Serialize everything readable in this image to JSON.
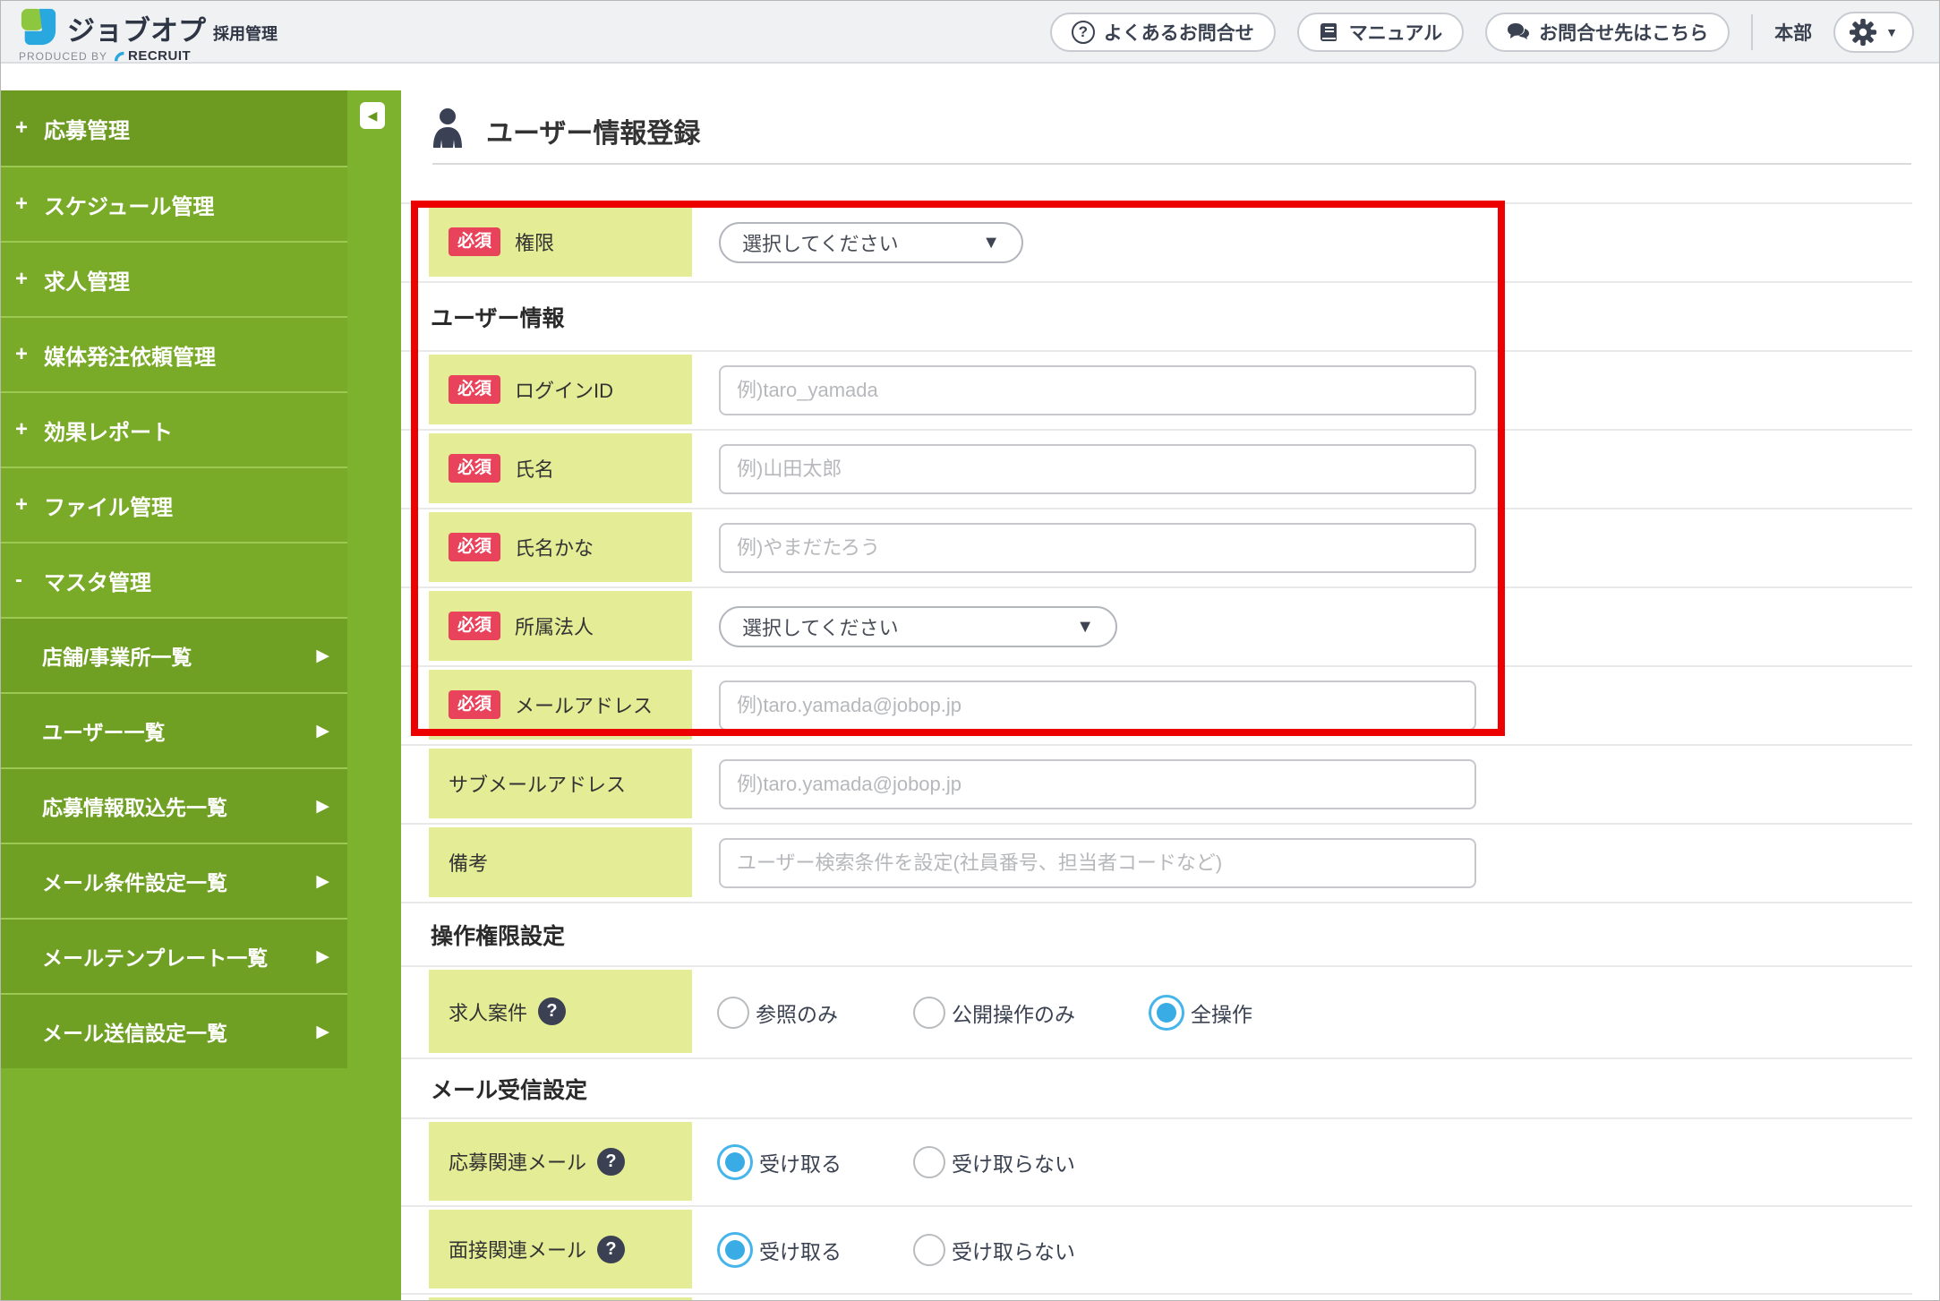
{
  "colors": {
    "sidebar_green": "#7cb22d",
    "label_cell_bg": "#e4ec95",
    "required_red": "#e8435a",
    "highlight_border_red": "#ec0000",
    "radio_selected_blue": "#39ace6",
    "icon_navy": "#3a4150"
  },
  "header": {
    "logo": {
      "product": "ジョブオプ",
      "suffix": "採用管理",
      "produced_by": "PRODUCED BY",
      "brand": "RECRUIT"
    },
    "nav_buttons": [
      {
        "label": "よくあるお問合せ",
        "icon": "question-circle-icon"
      },
      {
        "label": "マニュアル",
        "icon": "book-icon"
      },
      {
        "label": "お問合せ先はこちら",
        "icon": "chat-bubble-icon"
      }
    ],
    "org_label": "本部",
    "settings": {
      "icon": "gear-icon",
      "caret": "▼"
    }
  },
  "sidebar": {
    "collapse_icon": "◀",
    "arrow_icon": "▶",
    "items": [
      {
        "prefix": "+",
        "label": "応募管理"
      },
      {
        "prefix": "+",
        "label": "スケジュール管理"
      },
      {
        "prefix": "+",
        "label": "求人管理"
      },
      {
        "prefix": "+",
        "label": "媒体発注依頼管理"
      },
      {
        "prefix": "+",
        "label": "効果レポート"
      },
      {
        "prefix": "+",
        "label": "ファイル管理"
      },
      {
        "prefix": "-",
        "label": "マスタ管理"
      },
      {
        "prefix": "",
        "label": "店舗/事業所一覧"
      },
      {
        "prefix": "",
        "label": "ユーザー一覧"
      },
      {
        "prefix": "",
        "label": "応募情報取込先一覧"
      },
      {
        "prefix": "",
        "label": "メール条件設定一覧"
      },
      {
        "prefix": "",
        "label": "メールテンプレート一覧"
      },
      {
        "prefix": "",
        "label": "メール送信設定一覧"
      }
    ]
  },
  "page": {
    "title": "ユーザー情報登録",
    "required_badge": "必須",
    "select_caret": "▼",
    "help_icon": "?",
    "rows": [
      {
        "label": "権限",
        "required": true,
        "control": "select",
        "value": "選択してください"
      },
      {
        "type": "section",
        "label": "ユーザー情報"
      },
      {
        "label": "ログインID",
        "required": true,
        "control": "input",
        "placeholder": "例)taro_yamada"
      },
      {
        "label": "氏名",
        "required": true,
        "control": "input",
        "placeholder": "例)山田太郎"
      },
      {
        "label": "氏名かな",
        "required": true,
        "control": "input",
        "placeholder": "例)やまだたろう"
      },
      {
        "label": "所属法人",
        "required": true,
        "control": "select",
        "value": "選択してください"
      },
      {
        "label": "メールアドレス",
        "required": true,
        "control": "input",
        "placeholder": "例)taro.yamada@jobop.jp"
      },
      {
        "label": "サブメールアドレス",
        "required": false,
        "control": "input",
        "placeholder": "例)taro.yamada@jobop.jp"
      },
      {
        "label": "備考",
        "required": false,
        "control": "input",
        "placeholder": "ユーザー検索条件を設定(社員番号、担当者コードなど)"
      },
      {
        "type": "section",
        "label": "操作権限設定"
      },
      {
        "label": "求人案件",
        "required": false,
        "help": true,
        "control": "radio",
        "options": [
          {
            "label": "参照のみ",
            "selected": false
          },
          {
            "label": "公開操作のみ",
            "selected": false
          },
          {
            "label": "全操作",
            "selected": true
          }
        ]
      },
      {
        "type": "section",
        "label": "メール受信設定"
      },
      {
        "label": "応募関連メール",
        "required": false,
        "help": true,
        "control": "radio",
        "options": [
          {
            "label": "受け取る",
            "selected": true
          },
          {
            "label": "受け取らない",
            "selected": false
          }
        ]
      },
      {
        "label": "面接関連メール",
        "required": false,
        "help": true,
        "control": "radio",
        "options": [
          {
            "label": "受け取る",
            "selected": true
          },
          {
            "label": "受け取らない",
            "selected": false
          }
        ]
      }
    ]
  }
}
